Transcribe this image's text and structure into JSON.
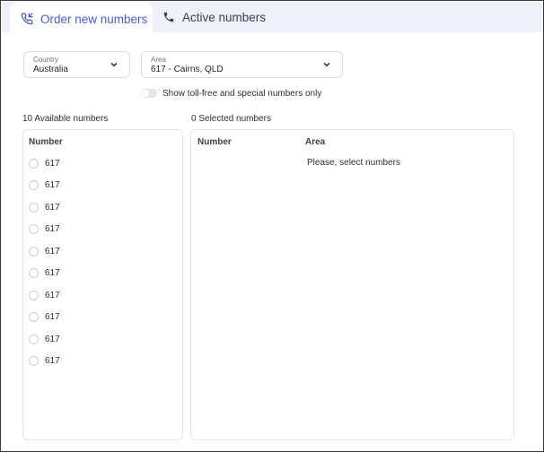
{
  "tabs": [
    {
      "label": "Order new numbers",
      "icon": "phone-incoming-icon",
      "active": true
    },
    {
      "label": "Active numbers",
      "icon": "phone-icon",
      "active": false
    }
  ],
  "filters": {
    "country": {
      "label": "Country",
      "value": "Australia"
    },
    "area": {
      "label": "Area",
      "value": "617 - Cairns, QLD"
    },
    "toggle": {
      "label": "Show toll-free and special numbers only",
      "on": false
    }
  },
  "available": {
    "title": "10 Available numbers",
    "column": "Number",
    "numbers": [
      "617",
      "617",
      "617",
      "617",
      "617",
      "617",
      "617",
      "617",
      "617",
      "617"
    ],
    "trail": "·"
  },
  "selected": {
    "title": "0 Selected numbers",
    "columns": {
      "number": "Number",
      "area": "Area"
    },
    "empty_message": "Please, select numbers"
  },
  "colors": {
    "accent": "#4a5bd0",
    "tab_bar": "#eef0fa"
  }
}
